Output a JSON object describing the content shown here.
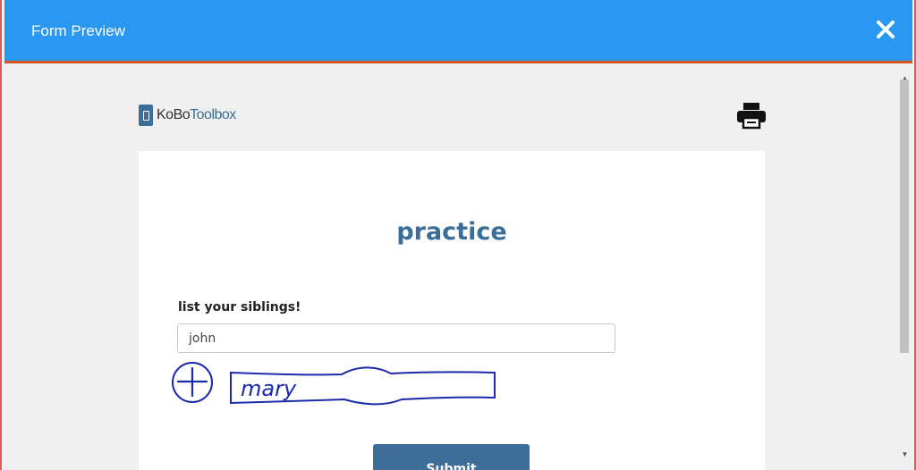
{
  "dialog": {
    "title": "Form Preview",
    "close_icon": "close-icon"
  },
  "branding": {
    "logo_part1": "KoBo",
    "logo_part2": "Toolbox",
    "print_icon": "printer-icon"
  },
  "form": {
    "title": "practice",
    "question_label": "list your siblings!",
    "answer_value": "john",
    "submit_label": "Submit"
  },
  "annotation": {
    "handwritten_text": "mary"
  },
  "colors": {
    "header_bg": "#2a97f0",
    "header_accent": "#d2581d",
    "brand_blue": "#3a6d98",
    "annotation_ink": "#1a2aa8"
  }
}
